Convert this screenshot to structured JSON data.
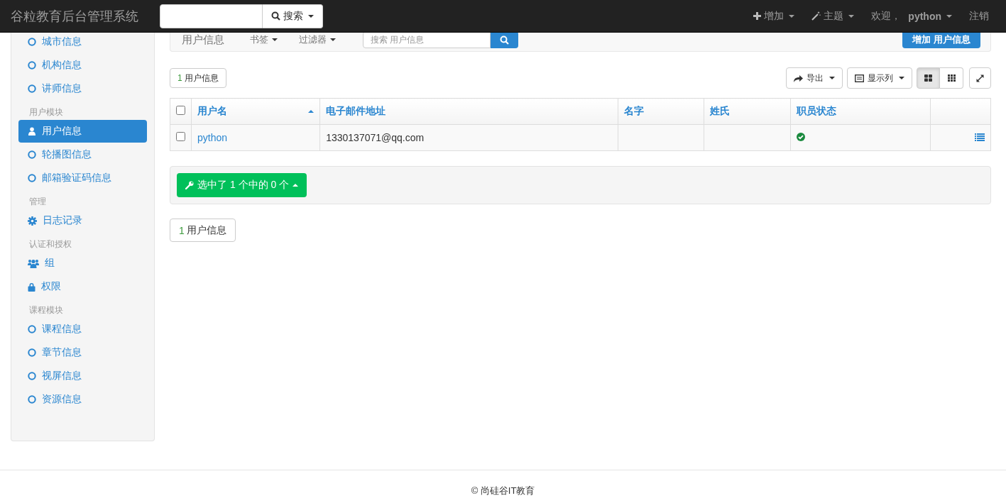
{
  "navbar": {
    "brand": "谷粒教育后台管理系统",
    "search_button": "搜索",
    "add_menu": "增加",
    "theme_menu": "主题",
    "welcome": "欢迎，",
    "user_menu": "python",
    "logout": "注销"
  },
  "sidebar": {
    "groups": [
      {
        "items": [
          {
            "label": "城市信息",
            "kind": "circle",
            "selected": false
          },
          {
            "label": "机构信息",
            "kind": "circle",
            "selected": false
          },
          {
            "label": "讲师信息",
            "kind": "circle",
            "selected": false
          }
        ]
      },
      {
        "title": "用户模块",
        "items": [
          {
            "label": "用户信息",
            "kind": "user",
            "selected": true
          },
          {
            "label": "轮播图信息",
            "kind": "circle",
            "selected": false
          },
          {
            "label": "邮箱验证码信息",
            "kind": "circle",
            "selected": false
          }
        ]
      },
      {
        "title": "管理",
        "items": [
          {
            "label": "日志记录",
            "kind": "gear",
            "selected": false
          }
        ]
      },
      {
        "title": "认证和授权",
        "items": [
          {
            "label": "组",
            "kind": "users",
            "selected": false
          },
          {
            "label": "权限",
            "kind": "lock",
            "selected": false
          }
        ]
      },
      {
        "title": "课程模块",
        "items": [
          {
            "label": "课程信息",
            "kind": "circle",
            "selected": false
          },
          {
            "label": "章节信息",
            "kind": "circle",
            "selected": false
          },
          {
            "label": "视屏信息",
            "kind": "circle",
            "selected": false
          },
          {
            "label": "资源信息",
            "kind": "circle",
            "selected": false
          }
        ]
      }
    ]
  },
  "header": {
    "title": "用户信息",
    "bookmarks": "书签",
    "filters": "过滤器",
    "search_placeholder": "搜索 用户信息",
    "add_button": "增加 用户信息"
  },
  "count_tag": {
    "number": "1",
    "label": "用户信息"
  },
  "toolbar": {
    "export": "导出",
    "columns": "显示列",
    "views": [
      {
        "kind": "large",
        "selected": true
      },
      {
        "kind": "small",
        "selected": false
      }
    ]
  },
  "table": {
    "all_checked": false,
    "columns": [
      {
        "label": "用户名",
        "sorted": true
      },
      {
        "label": "电子邮件地址",
        "sorted": false
      },
      {
        "label": "名字",
        "sorted": false
      },
      {
        "label": "姓氏",
        "sorted": false
      },
      {
        "label": "职员状态",
        "sorted": false
      }
    ],
    "rows": [
      {
        "checked": false,
        "username": "python",
        "email": "1330137071@qq.com",
        "staff": true
      }
    ]
  },
  "actions": {
    "selection": "选中了 1 个中的 0 个"
  },
  "pager": {
    "number": "1",
    "label": "用户信息"
  },
  "footer": "© 尚硅谷IT教育"
}
